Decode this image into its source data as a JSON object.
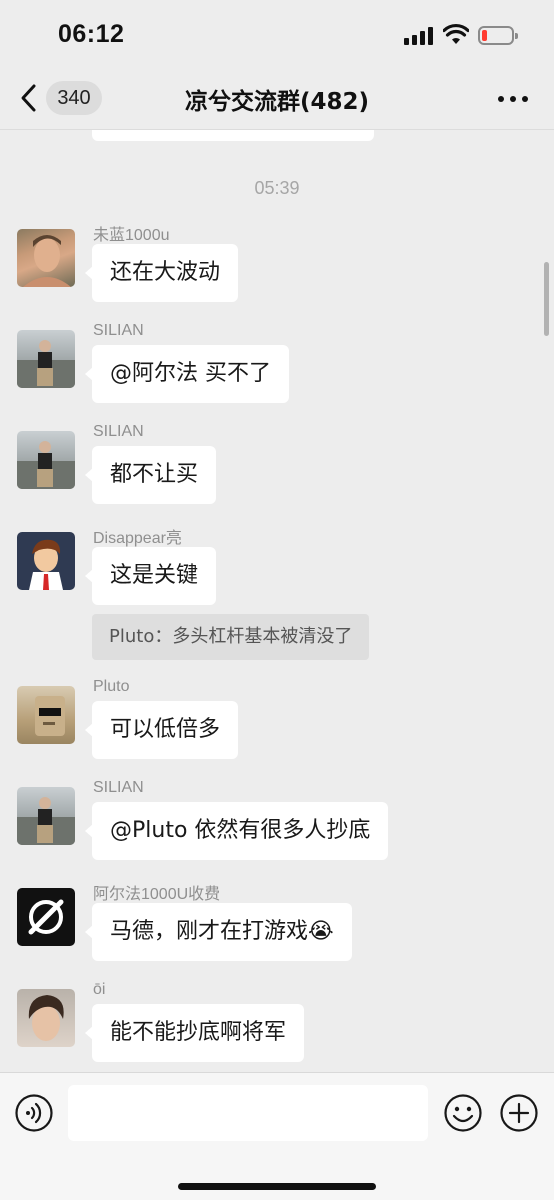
{
  "status_bar": {
    "time": "06:12",
    "battery_icon": "battery-low-icon",
    "battery_color": "#ff3b30"
  },
  "nav": {
    "unread_count": "340",
    "title": "凉兮交流群(482)",
    "back_icon": "chevron-left-icon",
    "more_icon": "more-dots-icon"
  },
  "chat": {
    "timestamp": "05:39",
    "messages": [
      {
        "sender": "未蓝1000u",
        "text": "还在大波动"
      },
      {
        "sender": "SILIAN",
        "text": "@阿尔法 买不了"
      },
      {
        "sender": "SILIAN",
        "text": "都不让买"
      },
      {
        "sender": "Disappear亮",
        "text": "这是关键",
        "quote": "Pluto：多头杠杆基本被清没了"
      },
      {
        "sender": "Pluto",
        "text": "可以低倍多"
      },
      {
        "sender": "SILIAN",
        "text": "@Pluto 依然有很多人抄底"
      },
      {
        "sender": "阿尔法1000U收费",
        "text": "马德，刚才在打游戏😭"
      },
      {
        "sender": "ōi",
        "text": "能不能抄底啊将军"
      }
    ]
  },
  "input_bar": {
    "placeholder": "",
    "voice_icon": "voice-icon",
    "emoji_icon": "emoji-icon",
    "plus_icon": "plus-circle-icon"
  },
  "colors": {
    "background": "#ededed",
    "bubble": "#ffffff",
    "quote_background": "#dedede",
    "sender_text": "#8f8f8f"
  }
}
